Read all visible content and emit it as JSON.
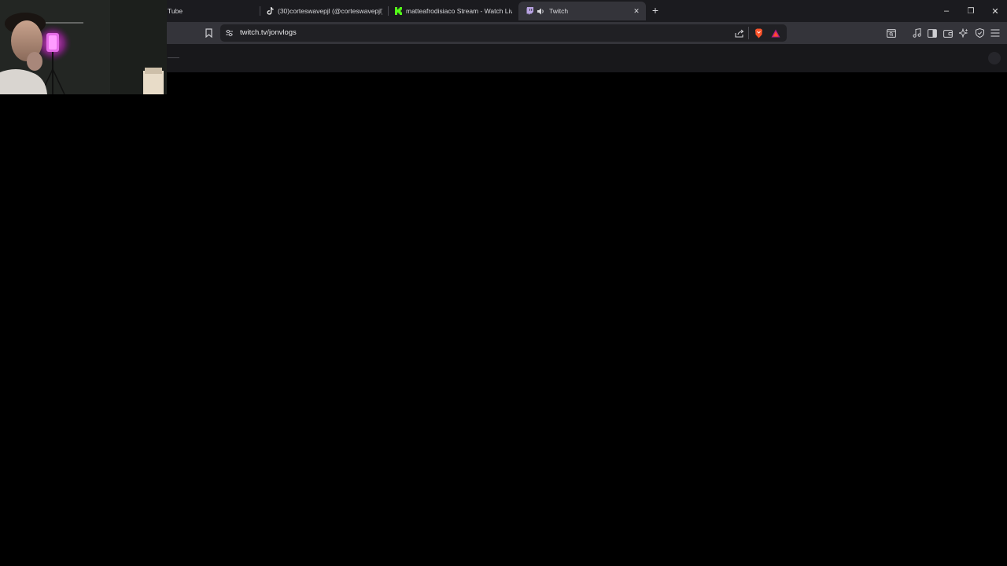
{
  "browser": {
    "tabs": [
      {
        "title": "Tube",
        "icon": "youtube-icon",
        "active": false
      },
      {
        "title": "(30)corteswavepjl (@corteswavepjl) |",
        "icon": "tiktok-icon",
        "active": false
      },
      {
        "title": "matteafrodisiaco Stream - Watch Liv",
        "icon": "kick-icon",
        "active": false
      },
      {
        "title": "Twitch",
        "icon": "twitch-icon",
        "active": true,
        "audio": "speaker-icon"
      }
    ],
    "new_tab_label": "+",
    "close_tab_label": "✕",
    "window_controls": {
      "minimize": "–",
      "restore": "❐",
      "close": "✕"
    },
    "url": "twitch.tv/jonvlogs"
  },
  "colors": {
    "tab_bar": "#1b1b1f",
    "toolbar": "#34343a",
    "url_bar": "#202024",
    "page_header": "#18181b",
    "page_background": "#000000",
    "kick_green": "#53fc18",
    "twitch_purple": "#9146ff",
    "brave_orange": "#fb542b"
  }
}
